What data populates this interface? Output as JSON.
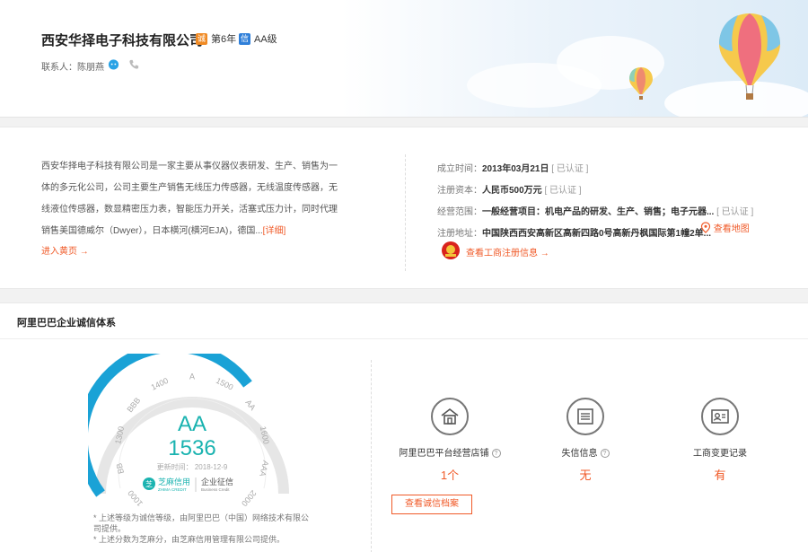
{
  "header": {
    "company_name": "西安华择电子科技有限公司",
    "years_label": "第6年",
    "level_label": "AA级",
    "contact_label": "联系人：陈朋燕"
  },
  "info": {
    "description": "西安华择电子科技有限公司是一家主要从事仪器仪表研发、生产、销售为一体的多元化公司，公司主要生产销售无线压力传感器，无线温度传感器，无线液位传感器，数显精密压力表，智能压力开关，活塞式压力计，同时代理销售美国德威尔（Dwyer），日本横河(横河EJA)，德国...",
    "detail_link": "[详细]",
    "enter_store": "进入黄页",
    "registration": [
      {
        "label": "成立时间：",
        "value": "2013年03月21日",
        "cert": "[ 已认证 ]"
      },
      {
        "label": "注册资本：",
        "value": "人民币500万元",
        "cert": "[ 已认证 ]"
      },
      {
        "label": "经营范围：",
        "value": "一般经营项目：机电产品的研发、生产、销售；电子元器...",
        "cert": "[ 已认证 ]"
      },
      {
        "label": "注册地址：",
        "value": "中国陕西西安高新区高新四路0号高新丹枫国际第1幢2单...",
        "cert": ""
      }
    ],
    "map_link": "查看地图",
    "ic_link": "查看工商注册信息"
  },
  "credit": {
    "title": "阿里巴巴企业诚信体系",
    "grade": "AA",
    "score": "1536",
    "update_time": "更新时间： 2018-12-9",
    "scale_labels": [
      "1000",
      "BB",
      "1300",
      "BBB",
      "1400",
      "A",
      "1500",
      "AA",
      "1600",
      "AAA",
      "2000"
    ],
    "zhima_label": "芝麻信用",
    "zhima_sub": "ZHIMA CREDIT",
    "enterprise_label": "企业征信",
    "enterprise_sub": "Business Credit",
    "note_1": "* 上述等级为诚信等级，由阿里巴巴（中国）网络技术有限公司提供。",
    "note_2": "* 上述分数为芝麻分，由芝麻信用管理有限公司提供。",
    "stats": [
      {
        "label": "阿里巴巴平台经营店铺",
        "value": "1个",
        "icon": "store-icon",
        "help": true
      },
      {
        "label": "失信信息",
        "value": "无",
        "icon": "list-icon",
        "help": true
      },
      {
        "label": "工商变更记录",
        "value": "有",
        "icon": "id-card-icon",
        "help": false
      }
    ],
    "archive_button": "查看诚信档案"
  },
  "colors": {
    "accent": "#f05a28",
    "gauge_blue": "#1aa2d6",
    "score_teal": "#1ab3b0"
  }
}
